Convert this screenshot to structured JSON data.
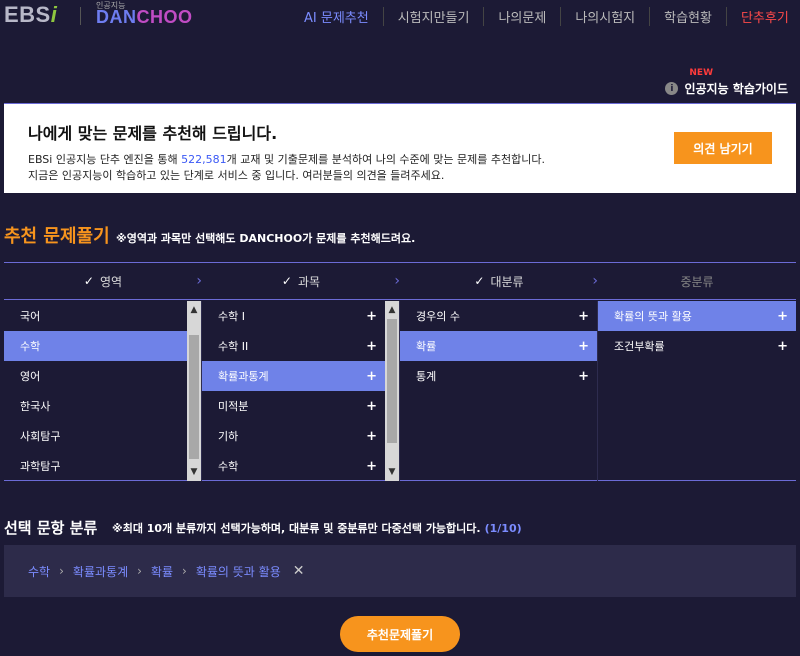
{
  "header": {
    "brand_left": "EBS",
    "brand_left_i": "i",
    "brand_small": "인공지능",
    "brand_d1": "DAN",
    "brand_d2": "CHOO",
    "nav": [
      {
        "label": "AI 문제추천"
      },
      {
        "label": "시험지만들기"
      },
      {
        "label": "나의문제"
      },
      {
        "label": "나의시험지"
      },
      {
        "label": "학습현황"
      },
      {
        "label": "단추후기"
      }
    ]
  },
  "guide": {
    "badge": "NEW",
    "info_glyph": "i",
    "label": "인공지능 학습가이드"
  },
  "banner": {
    "title": "나에게 맞는 문제를 추천해 드립니다.",
    "line1_pre": "EBSi 인공지능 단추 엔진을 통해 ",
    "line1_num": "522,581",
    "line1_post": "개 교재 및 기출문제를 분석하여 나의 수준에 맞는 문제를 추천합니다.",
    "line2": "지금은 인공지능이 학습하고 있는 단계로 서비스 중 입니다. 여러분들의 의견을 들려주세요.",
    "feedback_label": "의견 남기기"
  },
  "section": {
    "title": "추천 문제풀기",
    "note": "※영역과 과목만 선택해도 DANCHOO가 문제를 추천해드려요."
  },
  "steps": [
    {
      "label": "영역",
      "check": "✓",
      "active": true
    },
    {
      "label": "과목",
      "check": "✓",
      "active": true
    },
    {
      "label": "대분류",
      "check": "✓",
      "active": true
    },
    {
      "label": "중분류",
      "check": "",
      "active": false
    }
  ],
  "columns": {
    "area": [
      "국어",
      "수학",
      "영어",
      "한국사",
      "사회탐구",
      "과학탐구"
    ],
    "subject": [
      "수학 I",
      "수학 II",
      "확률과통계",
      "미적분",
      "기하",
      "수학"
    ],
    "major": [
      "경우의 수",
      "확률",
      "통계"
    ],
    "minor": [
      "확률의 뜻과 활용",
      "조건부확률"
    ]
  },
  "selected": {
    "title": "선택 문항 분류",
    "note": "※최대 10개 분류까지 선택가능하며, 대분류 및 중분류만 다중선택 가능합니다.",
    "count": "(1/10)",
    "path": [
      "수학",
      "확률과통계",
      "확률",
      "확률의 뜻과 활용"
    ],
    "remove_glyph": "✕"
  },
  "submit_label": "추천문제풀기"
}
